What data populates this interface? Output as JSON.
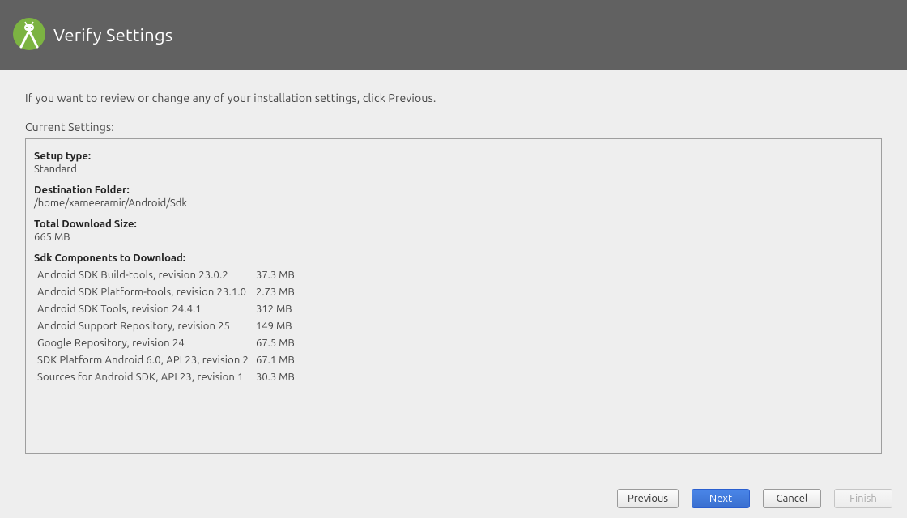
{
  "header": {
    "title": "Verify Settings"
  },
  "intro": "If you want to review or change any of your installation settings, click Previous.",
  "current_settings_label": "Current Settings:",
  "setup_type": {
    "label": "Setup type:",
    "value": "Standard"
  },
  "destination_folder": {
    "label": "Destination Folder:",
    "value": "/home/xameeramir/Android/Sdk"
  },
  "total_download_size": {
    "label": "Total Download Size:",
    "value": "665 MB"
  },
  "components": {
    "label": "Sdk Components to Download:",
    "items": [
      {
        "name": "Android SDK Build-tools, revision 23.0.2",
        "size": "37.3 MB"
      },
      {
        "name": "Android SDK Platform-tools, revision 23.1.0",
        "size": "2.73 MB"
      },
      {
        "name": "Android SDK Tools, revision 24.4.1",
        "size": "312 MB"
      },
      {
        "name": "Android Support Repository, revision 25",
        "size": "149 MB"
      },
      {
        "name": "Google Repository, revision 24",
        "size": "67.5 MB"
      },
      {
        "name": "SDK Platform Android 6.0, API 23, revision 2",
        "size": "67.1 MB"
      },
      {
        "name": "Sources for Android SDK, API 23, revision 1",
        "size": "30.3 MB"
      }
    ]
  },
  "buttons": {
    "previous": "Previous",
    "next": "Next",
    "cancel": "Cancel",
    "finish": "Finish"
  }
}
